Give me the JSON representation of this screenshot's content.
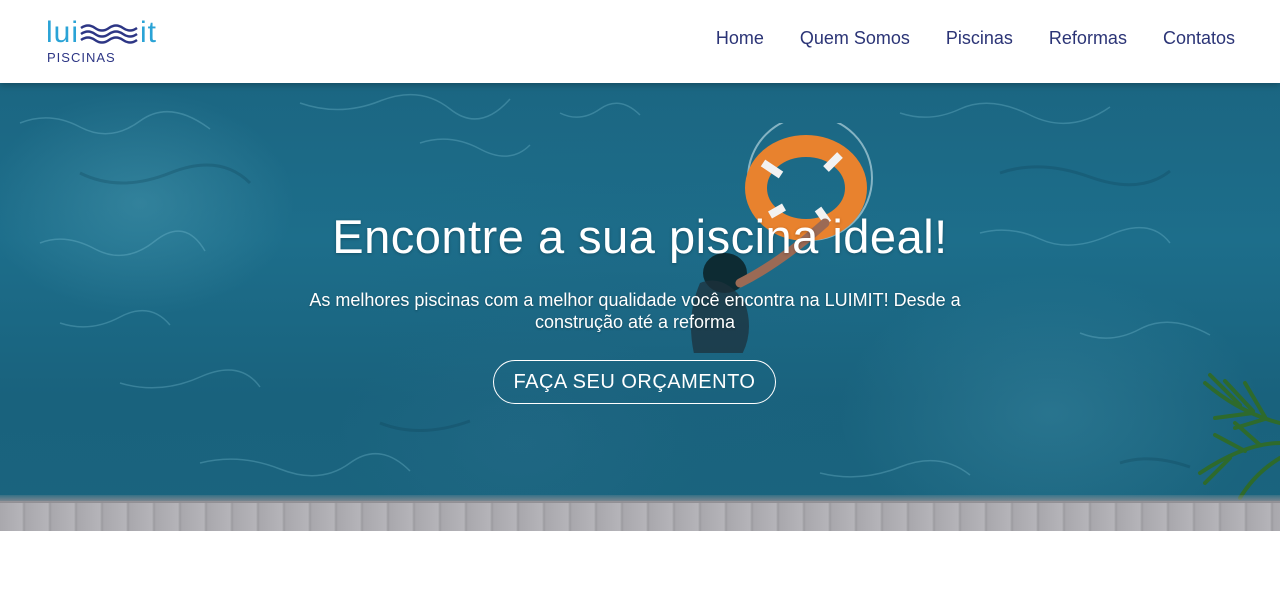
{
  "brand": {
    "logo_word_left": "lui",
    "logo_word_right": "it",
    "logo_subtitle": "PISCINAS",
    "accent_color": "#2aa3d6",
    "navy_color": "#2d3685"
  },
  "nav": {
    "items": [
      {
        "label": "Home"
      },
      {
        "label": "Quem Somos"
      },
      {
        "label": "Piscinas"
      },
      {
        "label": "Reformas"
      },
      {
        "label": "Contatos"
      }
    ]
  },
  "hero": {
    "title": "Encontre a sua piscina ideal!",
    "subtitle": "As melhores piscinas com a melhor qualidade você encontra na LUIMIT! Desde a construção até a reforma",
    "cta_label": "FAÇA SEU ORÇAMENTO",
    "water_color": "#1b6682"
  },
  "icons": [
    "logo-waves-icon",
    "palm-leaf-icon",
    "lifebuoy-icon"
  ]
}
